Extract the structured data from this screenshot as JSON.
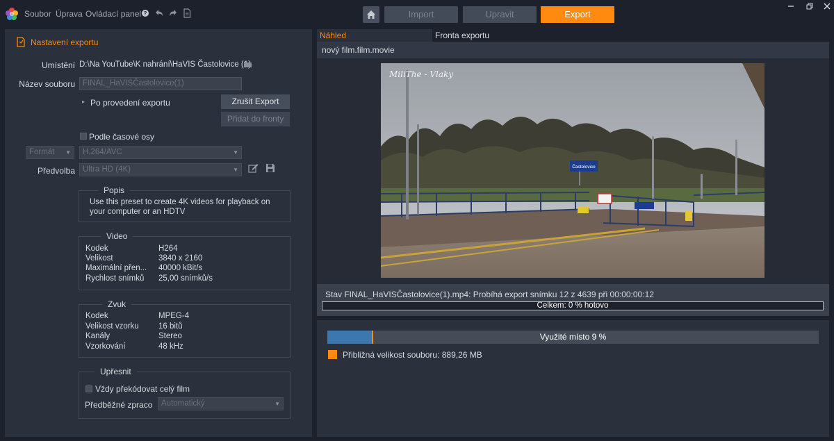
{
  "menu": {
    "file": "Soubor",
    "edit": "Úprava",
    "control_panel": "Ovládací panel"
  },
  "modes": {
    "import": "Import",
    "edit": "Upravit",
    "export": "Export"
  },
  "export_settings": {
    "title": "Nastavení exportu",
    "location_label": "Umístění",
    "location_value": "D:\\Na YouTube\\K nahrání\\HaVIS Častolovice (1)",
    "filename_label": "Název souboru",
    "filename_value": "FINAL_HaVISČastolovice(1)",
    "after_export_label": "Po provedení exportu",
    "cancel_export": "Zrušit Export",
    "add_to_queue": "Přidat do fronty",
    "timeline_checkbox": "Podle časové osy",
    "format_label": "Formát",
    "format_value": "H.264/AVC",
    "preset_label": "Předvolba",
    "preset_value": "Ultra HD (4K)"
  },
  "description": {
    "title": "Popis",
    "text": "Use this preset to create 4K videos for playback on your computer or an HDTV"
  },
  "video": {
    "title": "Video",
    "rows": [
      {
        "key": "Kodek",
        "value": "H264"
      },
      {
        "key": "Velikost",
        "value": "3840 x 2160"
      },
      {
        "key": "Maximální přen...",
        "value": "40000 kBit/s"
      },
      {
        "key": "Rychlost snímků",
        "value": "25,00 snímků/s"
      }
    ]
  },
  "audio": {
    "title": "Zvuk",
    "rows": [
      {
        "key": "Kodek",
        "value": "MPEG-4"
      },
      {
        "key": "Velikost vzorku",
        "value": "16 bitů"
      },
      {
        "key": "Kanály",
        "value": "Stereo"
      },
      {
        "key": "Vzorkování",
        "value": "48 kHz"
      }
    ]
  },
  "refine": {
    "title": "Upřesnit",
    "always_transcode": "Vždy překódovat celý film",
    "prerender_label": "Předběžné zpraco",
    "prerender_value": "Automatický"
  },
  "preview": {
    "tab_preview": "Náhled",
    "tab_queue": "Fronta exportu",
    "file_title": "nový film.film.movie",
    "watermark": "MiliThe - Vlaky",
    "station_sign": "Častolovice",
    "status": "Stav FINAL_HaVISČastolovice(1).mp4: Probíhá export snímku 12 z 4639 při 00:00:00:12",
    "total_progress": "Celkem: 0 % hotovo",
    "total_progress_percent": 0
  },
  "disk": {
    "usage_label": "Využité místo 9 %",
    "usage_percent": 9,
    "estimate_label": "Přibližná velikost souboru: 889,26 MB"
  },
  "colors": {
    "accent": "#ff8a0f",
    "usage_fill": "#3e77ab"
  }
}
